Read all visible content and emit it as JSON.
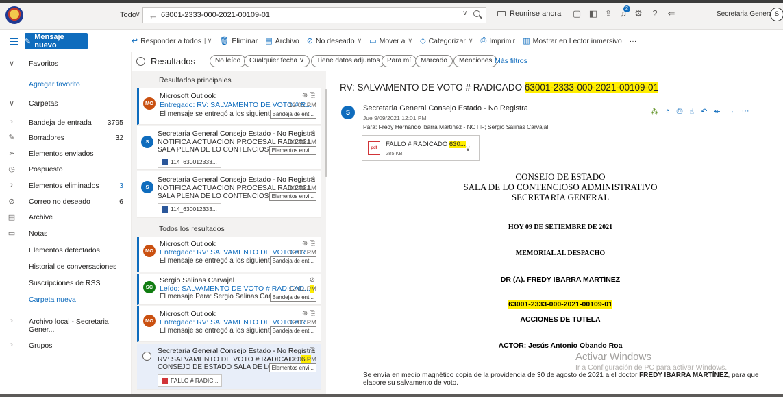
{
  "topbar": {
    "scope": "Todo",
    "search_value": "63001-2333-000-2021-00109-01",
    "meet_label": "Reunirse ahora",
    "badge_count": "2",
    "user_name": "Secretaria General...",
    "user_initial": "S"
  },
  "command": {
    "new_mail": "Mensaje nuevo",
    "reply_all": "Responder a todos",
    "delete": "Eliminar",
    "archive": "Archivo",
    "junk": "No deseado",
    "move": "Mover a",
    "categorize": "Categorizar",
    "print": "Imprimir",
    "reader": "Mostrar en Lector inmersivo",
    "more": "···"
  },
  "nav": {
    "favorites": "Favoritos",
    "add_favorite": "Agregar favorito",
    "folders": "Carpetas",
    "items": [
      {
        "label": "Bandeja de entrada",
        "count": "3795"
      },
      {
        "label": "Borradores",
        "count": "32"
      },
      {
        "label": "Elementos enviados",
        "count": ""
      },
      {
        "label": "Pospuesto",
        "count": ""
      },
      {
        "label": "Elementos eliminados",
        "count": "3"
      },
      {
        "label": "Correo no deseado",
        "count": "6"
      },
      {
        "label": "Archive",
        "count": ""
      },
      {
        "label": "Notas",
        "count": ""
      },
      {
        "label": "Elementos detectados",
        "count": ""
      },
      {
        "label": "Historial de conversaciones",
        "count": ""
      },
      {
        "label": "Suscripciones de RSS",
        "count": ""
      },
      {
        "label": "Carpeta nueva",
        "count": ""
      }
    ],
    "local_archive": "Archivo local - Secretaria Gener...",
    "groups": "Grupos"
  },
  "filters": {
    "results": "Resultados",
    "chips": [
      "No leído",
      "Cualquier fecha",
      "Tiene datos adjuntos",
      "Para mí",
      "Marcado",
      "Menciones"
    ],
    "more": "Más filtros"
  },
  "list": {
    "top_section": "Resultados principales",
    "all_section": "Todos los resultados",
    "top": [
      {
        "initials": "MO",
        "sender": "Microsoft Outlook",
        "subject": "Entregado: RV: SALVAMENTO DE VOTO # R...",
        "time": "12:01 PM",
        "preview": "El mensaje se entregó a los siguiente...",
        "folder": "Bandeja de ent..."
      },
      {
        "initials": "S",
        "sender": "Secretaria General Consejo Estado - No Registra",
        "subject": "NOTIFICA ACTUACION PROCESAL RAD 2021...",
        "time": "10:42 AM",
        "preview": "SALA PLENA DE LO CONTENCIOSO ...",
        "folder": "Elementos envi...",
        "attachment": "114_630012333..."
      },
      {
        "initials": "S",
        "sender": "Secretaria General Consejo Estado - No Registra",
        "subject": "NOTIFICA ACTUACION PROCESAL RAD 2021...",
        "time": "10:42 AM",
        "preview": "SALA PLENA DE LO CONTENCIOSO ...",
        "folder": "Elementos envi...",
        "attachment": "114_630012333..."
      }
    ],
    "all": [
      {
        "initials": "MO",
        "sender": "Microsoft Outlook",
        "subject": "Entregado: RV: SALVAMENTO DE VOTO # R...",
        "time": "12:01 PM",
        "preview": "El mensaje se entregó a los siguiente...",
        "folder": "Bandeja de ent..."
      },
      {
        "initials": "SC",
        "sender": "Sergio Salinas Carvajal",
        "subject_prefix": "Leído: SALVAMENTO DE VOTO # RADICAD...",
        "time": "12:01 PM",
        "preview": "El mensaje Para: Sergio Salinas Carva...",
        "folder": "Bandeja de ent..."
      },
      {
        "initials": "MO",
        "sender": "Microsoft Outlook",
        "subject": "Entregado: RV: SALVAMENTO DE VOTO # R...",
        "time": "12:01 PM",
        "preview": "El mensaje se entregó a los siguiente...",
        "folder": "Bandeja de ent..."
      },
      {
        "sender": "Secretaria General Consejo Estado - No Registra",
        "subject_prefix": "RV: SALVAMENTO DE VOTO # RADICADO ",
        "subject_hl": "6...",
        "time": "12:01 PM",
        "preview": "CONSEJO DE ESTADO SALA DE LO C...",
        "folder": "Elementos envi...",
        "attachment": "FALLO # RADIC..."
      }
    ]
  },
  "reading": {
    "subject_prefix": "RV: SALVAMENTO DE VOTO # RADICADO ",
    "subject_hl": "63001-2333-000-2021-00109-01",
    "avatar": "S",
    "from": "Secretaria General Consejo Estado - No Registra",
    "date": "Jue 9/09/2021 12:01 PM",
    "to": "Para:  Fredy Hernando Ibarra Martínez - NOTIF; Sergio Salinas Carvajal",
    "attachment_prefix": "FALLO # RADICADO ",
    "attachment_hl": "630...",
    "attachment_size": "285 KB",
    "doc": {
      "line1": "CONSEJO DE ESTADO",
      "line2": "SALA DE LO CONTENCIOSO ADMINISTRATIVO",
      "line3": "SECRETARIA GENERAL",
      "date": "HOY   09 DE SETIEMBRE DE 2021",
      "memorial": "MEMORIAL AL DESPACHO",
      "judge": "DR (A). FREDY IBARRA MARTÍNEZ",
      "radicado": "63001-2333-000-2021-00109-01",
      "acciones": "ACCIONES DE TUTELA",
      "actor": "ACTOR: Jesús Antonio Obando Roa"
    },
    "body_prefix": "Se envía en medio magnético copia de la providencia de 30 de agosto de 2021 a el doctor ",
    "body_bold": "FREDY IBARRA MARTÍNEZ",
    "body_suffix": ", para que elabore su salvamento de voto."
  },
  "watermark": {
    "line1": "Activar Windows",
    "line2": "Ir a Configuración de PC para activar Windows."
  },
  "colors": {
    "accent": "#0f6cbd",
    "highlight": "#ffee00"
  }
}
